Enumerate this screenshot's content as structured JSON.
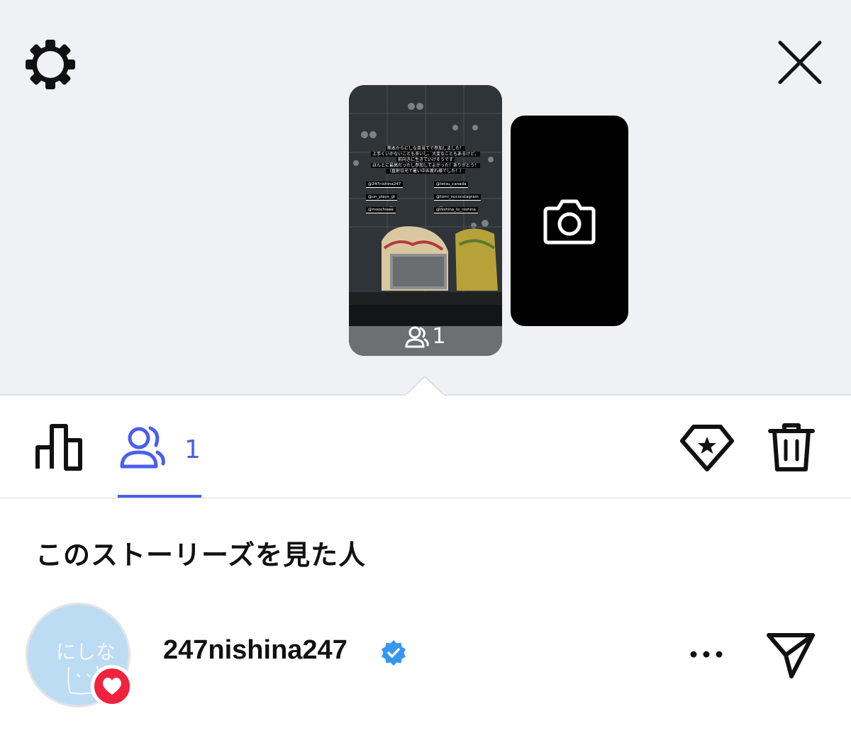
{
  "story": {
    "overlay_lines": [
      "熊本からにしな目当てで参加しました！",
      "上手くいかないことも多いし、大変なこともあるけど、",
      "前向きに生きていけそうです",
      "ほんとに最高だったし参加してよかった！ありがとう！",
      "（直射日光で暑い中お疲れ様でした！）"
    ],
    "tags": [
      "@247nishina247",
      "@tetsu_canada",
      "@un_plays_gt",
      "@tomi_nococstagram",
      "@moochieee",
      "@nishina_to_nishina"
    ],
    "viewer_count": "1"
  },
  "tabs": {
    "viewers_count": "1"
  },
  "section_title": "このストーリーズを見た人",
  "viewer": {
    "username": "247nishina247",
    "avatar_text": "にしな",
    "verified": true
  },
  "colors": {
    "accent": "#4a5ef0",
    "like_red": "#f0223d",
    "verified_blue": "#3797f0",
    "top_bg": "#eff1f4"
  },
  "icons": {
    "settings": "gear-icon",
    "close": "close-icon",
    "camera": "camera-icon",
    "insights": "bar-chart-icon",
    "viewers": "people-icon",
    "highlight": "highlight-diamond-icon",
    "delete": "trash-icon",
    "like": "heart-icon",
    "verified": "verified-badge-icon",
    "more": "more-icon",
    "send": "send-icon"
  }
}
